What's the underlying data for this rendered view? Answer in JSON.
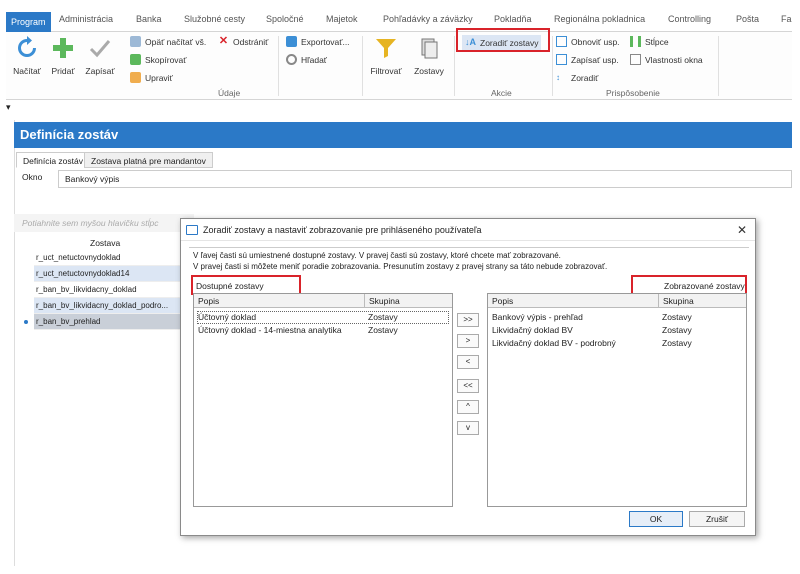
{
  "ribbon_tabs": [
    "Program",
    "Administrácia",
    "Banka",
    "Služobné cesty",
    "Spoločné",
    "Majetok",
    "Pohľadávky a záväzky",
    "Pokladňa",
    "Regionálna pokladnica",
    "Controlling",
    "Pošta",
    "Fa"
  ],
  "ribbon": {
    "nacitat": "Načítať",
    "pridat": "Pridať",
    "zapisat": "Zapísať",
    "opat_nacitat": "Opäť načítať vš.",
    "odstranit": "Odstrániť",
    "skopirovat": "Skopírovať",
    "upravit": "Upraviť",
    "exportovat": "Exportovať...",
    "hladat": "Hľadať",
    "filtrovat": "Filtrovať",
    "zostavy": "Zostavy",
    "zoradit_zostavy": "Zoradiť zostavy",
    "obnovit_usp": "Obnoviť usp.",
    "stlpce": "Stĺpce",
    "zapisat_usp": "Zapísať usp.",
    "vlastnosti_okna": "Vlastnosti okna",
    "zoradit": "Zoradiť",
    "group_udaje": "Údaje",
    "group_akcie": "Akcie",
    "group_prisposobenie": "Prispôsobenie"
  },
  "page": {
    "title": "Definícia zostáv",
    "subtabs": [
      "Definícia zostáv",
      "Zostava platná pre mandantov"
    ],
    "okno_label": "Okno",
    "okno_value": "Bankový výpis",
    "group_hint": "Potiahnite sem myšou hlavičku stĺpc",
    "column_header": "Zostava",
    "rows": [
      "r_uct_netuctovnydoklad",
      "r_uct_netuctovnydoklad14",
      "r_ban_bv_likvidacny_doklad",
      "r_ban_bv_likvidacny_doklad_podro...",
      "r_ban_bv_prehlad"
    ]
  },
  "dialog": {
    "title": "Zoradiť zostavy a nastaviť zobrazovanie pre prihláseného používateľa",
    "info_line1": "V ľavej časti sú umiestnené dostupné zostavy. V pravej časti sú zostavy, ktoré chcete mať zobrazované.",
    "info_line2": "V pravej časti si môžete meniť poradie zobrazovania. Presunutím zostavy z pravej strany sa táto nebude zobrazovať.",
    "available_label": "Dostupné zostavy",
    "displayed_label": "Zobrazované zostavy",
    "col_popis": "Popis",
    "col_skupina": "Skupina",
    "available": [
      {
        "popis": "Účtovný doklad",
        "skupina": "Zostavy"
      },
      {
        "popis": "Účtovný doklad - 14-miestna analytika",
        "skupina": "Zostavy"
      }
    ],
    "displayed": [
      {
        "popis": "Bankový výpis - prehľad",
        "skupina": "Zostavy"
      },
      {
        "popis": "Likvidačný doklad BV",
        "skupina": "Zostavy"
      },
      {
        "popis": "Likvidačný doklad BV - podrobný",
        "skupina": "Zostavy"
      }
    ],
    "move_buttons": [
      ">>",
      ">",
      "<",
      "<<",
      "^",
      "v"
    ],
    "ok": "OK",
    "cancel": "Zrušiť"
  },
  "colors": {
    "accent": "#2b79c7",
    "highlight": "#d9232a"
  }
}
